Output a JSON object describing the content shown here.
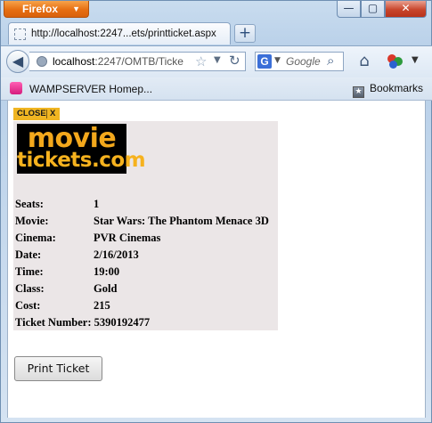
{
  "browser": {
    "app_button": "Firefox",
    "window_controls": {
      "minimize": "—",
      "maximize": "▢",
      "close": "✕"
    },
    "tab": {
      "title": "http://localhost:2247...ets/printticket.aspx",
      "close": "×"
    },
    "newtab": "+",
    "url": {
      "host": "localhost",
      "rest": ":2247/OMTB/Ticke"
    },
    "search": {
      "engine": "G",
      "placeholder": "Google"
    },
    "bookmarks": {
      "left_item": "WAMPSERVER Homep...",
      "right_item": "Bookmarks"
    },
    "icons": {
      "back": "back-arrow-icon",
      "page": "globe-icon",
      "star": "star-icon",
      "reload": "reload-icon",
      "search": "magnifier-icon",
      "home": "home-icon",
      "addon": "addon-icon",
      "bookmarks": "bookmarks-icon"
    }
  },
  "page": {
    "close_tag": {
      "label": "CLOSE",
      "x": "X"
    },
    "logo": {
      "line1": "movie",
      "line2": "tickets.com"
    },
    "ticket": [
      {
        "label": "Seats:",
        "value": "1"
      },
      {
        "label": "Movie:",
        "value": "Star Wars: The Phantom Menace 3D"
      },
      {
        "label": "Cinema:",
        "value": "PVR Cinemas"
      },
      {
        "label": "Date:",
        "value": "2/16/2013"
      },
      {
        "label": "Time:",
        "value": "19:00"
      },
      {
        "label": "Class:",
        "value": "Gold"
      },
      {
        "label": "Cost:",
        "value": "215"
      },
      {
        "label": "Ticket Number:",
        "value": "5390192477",
        "inline": true
      }
    ],
    "print_button": "Print Ticket"
  },
  "colors": {
    "close_tag_bg": "#f0b522",
    "ticket_bg": "#ebe6e7",
    "logo_text": "#f3a81c",
    "firefox_button": "#e66f12"
  }
}
